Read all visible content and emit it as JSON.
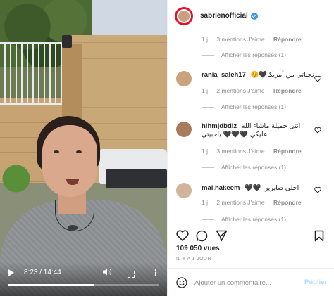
{
  "video": {
    "time": "8:23 / 14:44",
    "progress": 0.569
  },
  "header": {
    "username": "sabrienofficial"
  },
  "comments": [
    {
      "meta": {
        "age": "1 j",
        "likes": "3 mentions J'aime",
        "reply": "Répondre"
      },
      "replies": "Afficher les réponses (1)"
    },
    {
      "user": "rania_saleh17",
      "text": "نجباتي من أمريكا🖤☺️",
      "meta": {
        "age": "1 j",
        "likes": "2 mentions J'aime",
        "reply": "Répondre"
      },
      "replies": "Afficher les réponses (1)"
    },
    {
      "user": "hlhmjdbdlz",
      "text": "انتي جميلة ماشاء الله عليكي 🖤🖤🖤 ياحبيتي",
      "meta": {
        "age": "1 j",
        "likes": "3 mentions J'aime",
        "reply": "Répondre"
      },
      "replies": "Afficher les réponses (1)"
    },
    {
      "user": "mai.hakeem",
      "text": "احلى صابرين 🖤🖤",
      "meta": {
        "age": "1 j",
        "likes": "2 mentions J'aime",
        "reply": "Répondre"
      },
      "replies": "Afficher les réponses (1)"
    }
  ],
  "stats": {
    "views": "109 050 vues",
    "date": "IL Y A 1 JOUR"
  },
  "add_comment": {
    "placeholder": "Ajouter un commentaire...",
    "post_label": "Publier"
  },
  "colors": {
    "verified": "#3897f0",
    "post_disabled": "#b3dbff",
    "avatar_ring": "#e0142e"
  }
}
